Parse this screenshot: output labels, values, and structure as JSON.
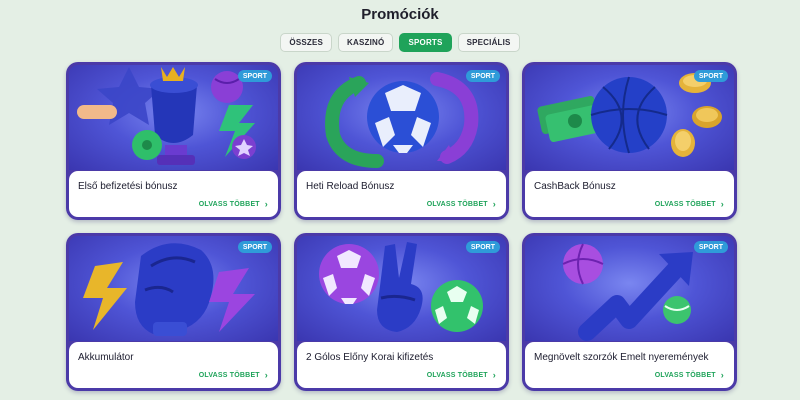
{
  "page": {
    "title": "Promóciók"
  },
  "filters": [
    {
      "label": "ÖSSZES",
      "active": false
    },
    {
      "label": "KASZINÓ",
      "active": false
    },
    {
      "label": "SPORTS",
      "active": true
    },
    {
      "label": "SPECIÁLIS",
      "active": false
    }
  ],
  "cards": [
    {
      "badge": "SPORT",
      "title": "Első befizetési bónusz",
      "link": "OLVASS TÖBBET",
      "icon": "trophy-football-illustration"
    },
    {
      "badge": "SPORT",
      "title": "Heti Reload Bónusz",
      "link": "OLVASS TÖBBET",
      "icon": "football-arrows-illustration"
    },
    {
      "badge": "SPORT",
      "title": "CashBack Bónusz",
      "link": "OLVASS TÖBBET",
      "icon": "basketball-cash-coins-illustration"
    },
    {
      "badge": "SPORT",
      "title": "Akkumulátor",
      "link": "OLVASS TÖBBET",
      "icon": "boxing-glove-lightning-illustration"
    },
    {
      "badge": "SPORT",
      "title": "2 Gólos Előny Korai kifizetés",
      "link": "OLVASS TÖBBET",
      "icon": "victory-hand-balls-illustration"
    },
    {
      "badge": "SPORT",
      "title": "Megnövelt szorzók Emelt nyeremények",
      "link": "OLVASS TÖBBET",
      "icon": "rising-arrow-balls-illustration"
    }
  ],
  "colors": {
    "accent": "#1fa35a",
    "card_frame": "#4b3aa8",
    "badge": "#2f9bd9",
    "background": "#e4efe5"
  }
}
